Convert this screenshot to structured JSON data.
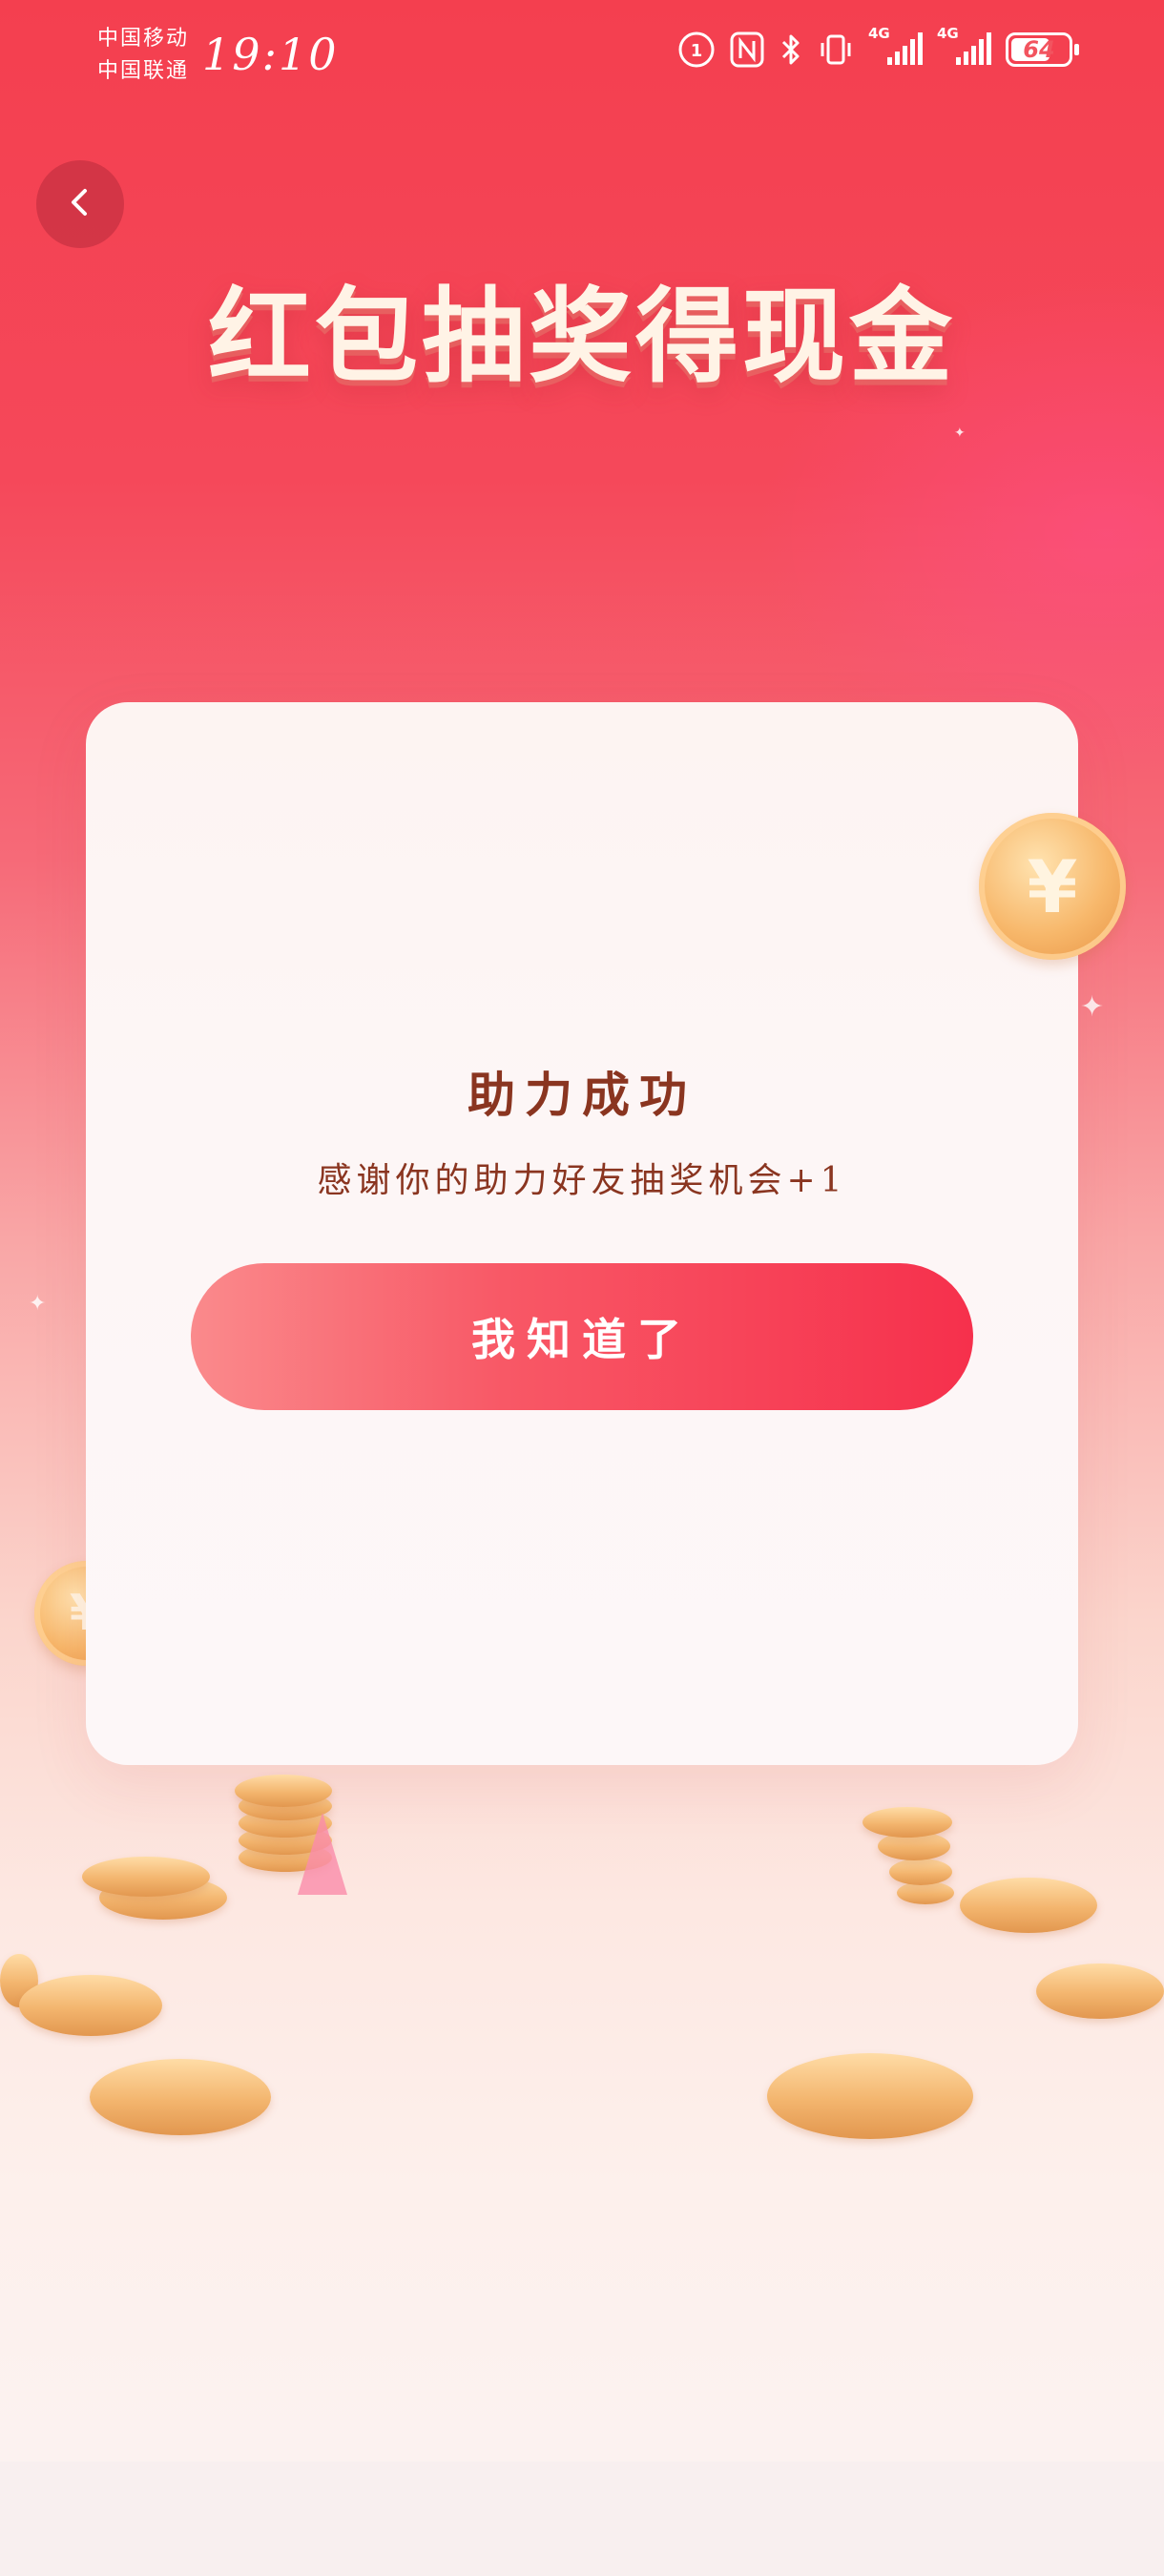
{
  "status_bar": {
    "carrier_1": "中国移动",
    "carrier_2": "中国联通",
    "time": "19:10",
    "network_1": "4G",
    "network_2": "4G",
    "battery_level": "64"
  },
  "header": {
    "title": "红包抽奖得现金"
  },
  "dialog": {
    "title": "助力成功",
    "message": "感谢你的助力好友抽奖机会+1",
    "confirm_label": "我知道了"
  },
  "icons": {
    "back": "chevron-left-icon",
    "coin_symbol": "¥"
  },
  "colors": {
    "background_top": "#f43f4f",
    "background_bottom": "#fbf3f2",
    "button_start": "#fa8a8c",
    "button_end": "#f6304c",
    "dialog_text": "#8a3520"
  }
}
